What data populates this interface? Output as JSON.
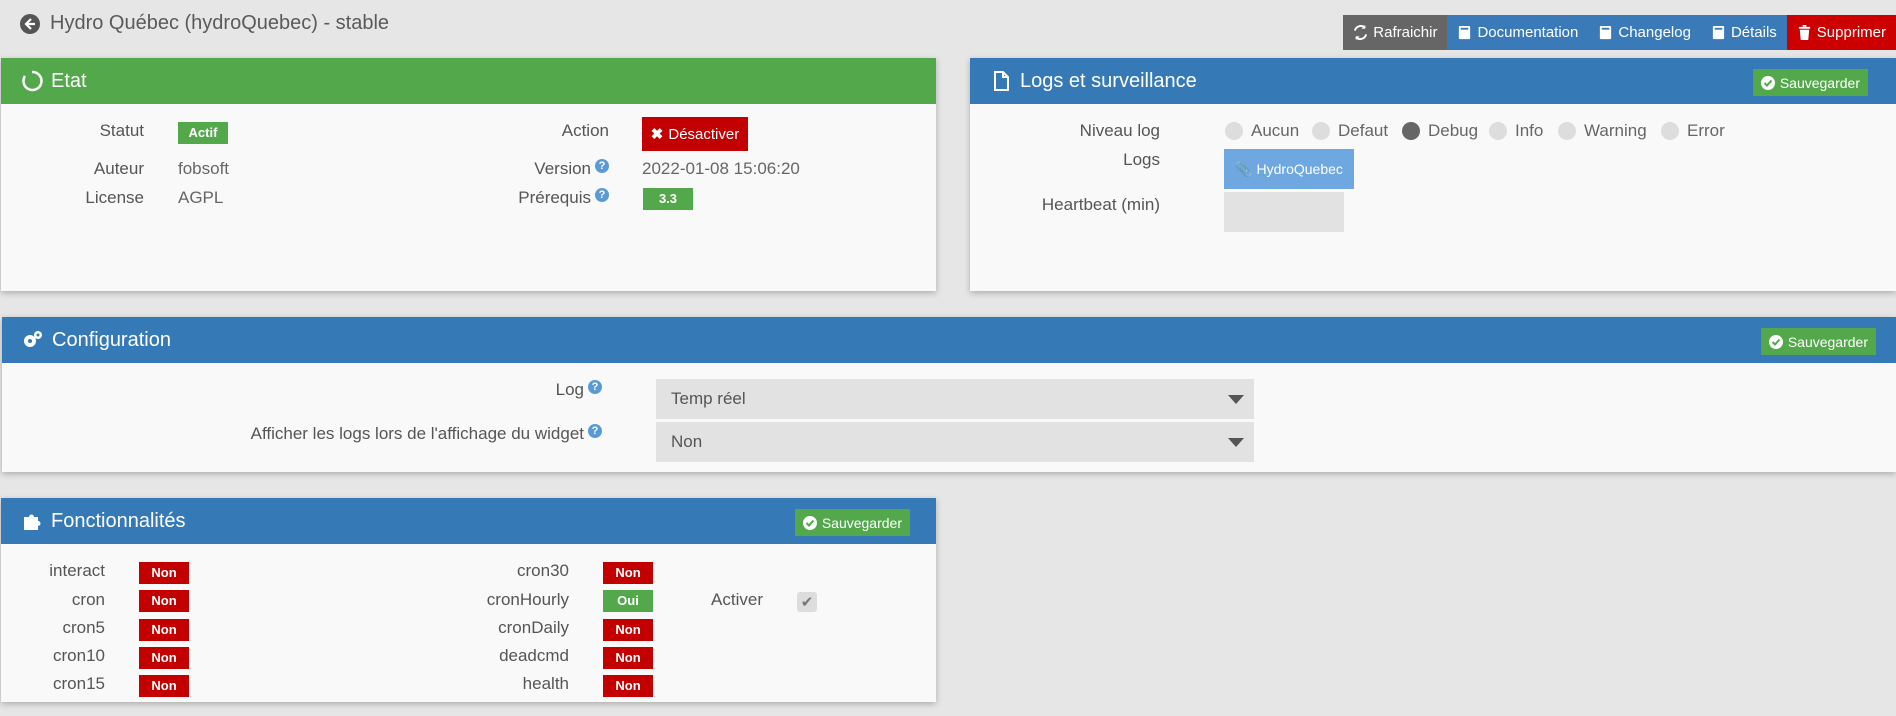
{
  "page": {
    "title": "Hydro Québec (hydroQuebec) - stable"
  },
  "toolbar": {
    "refresh": "Rafraichir",
    "documentation": "Documentation",
    "changelog": "Changelog",
    "details": "Détails",
    "delete": "Supprimer"
  },
  "etat": {
    "title": "Etat",
    "statut_label": "Statut",
    "statut_value": "Actif",
    "auteur_label": "Auteur",
    "auteur_value": "fobsoft",
    "license_label": "License",
    "license_value": "AGPL",
    "action_label": "Action",
    "action_button": "Désactiver",
    "version_label": "Version",
    "version_value": "2022-01-08 15:06:20",
    "prerequis_label": "Prérequis",
    "prerequis_value": "3.3"
  },
  "logs": {
    "title": "Logs et surveillance",
    "save": "Sauvegarder",
    "niveau_label": "Niveau log",
    "levels": [
      "Aucun",
      "Defaut",
      "Debug",
      "Info",
      "Warning",
      "Error"
    ],
    "selected_level": "Debug",
    "logs_label": "Logs",
    "log_button": "HydroQuebec",
    "heartbeat_label": "Heartbeat (min)",
    "heartbeat_value": ""
  },
  "configuration": {
    "title": "Configuration",
    "save": "Sauvegarder",
    "log_label": "Log",
    "log_value": "Temp réel",
    "widget_label": "Afficher les logs lors de l'affichage du widget",
    "widget_value": "Non"
  },
  "features": {
    "title": "Fonctionnalités",
    "save": "Sauvegarder",
    "left": [
      {
        "name": "interact",
        "value": "Non"
      },
      {
        "name": "cron",
        "value": "Non"
      },
      {
        "name": "cron5",
        "value": "Non"
      },
      {
        "name": "cron10",
        "value": "Non"
      },
      {
        "name": "cron15",
        "value": "Non"
      }
    ],
    "right": [
      {
        "name": "cron30",
        "value": "Non"
      },
      {
        "name": "cronHourly",
        "value": "Oui"
      },
      {
        "name": "cronDaily",
        "value": "Non"
      },
      {
        "name": "deadcmd",
        "value": "Non"
      },
      {
        "name": "health",
        "value": "Non"
      }
    ],
    "activer_label": "Activer",
    "activer_checked": true
  },
  "colors": {
    "green": "#53a84b",
    "blue": "#3579b7",
    "red": "#c20000",
    "toolbar_gray": "#666666"
  }
}
